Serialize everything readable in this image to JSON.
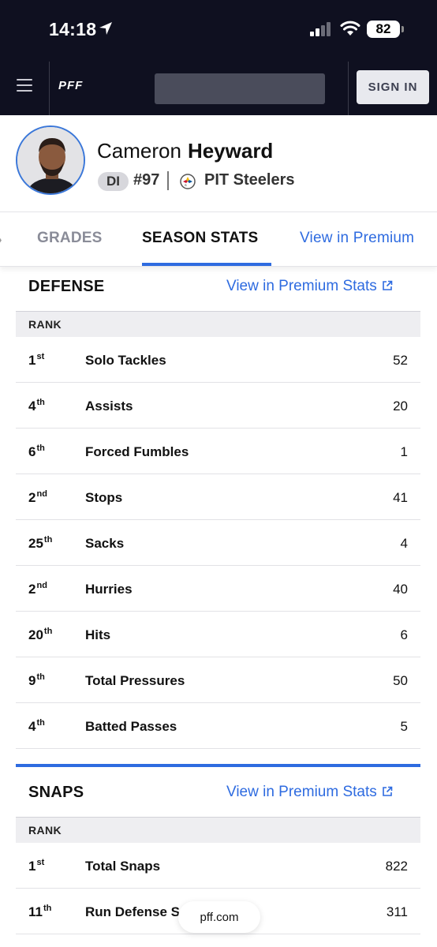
{
  "status_bar": {
    "time": "14:18",
    "battery": "82"
  },
  "header": {
    "logo": "PFF",
    "sign_in": "SIGN IN"
  },
  "player": {
    "first_name": "Cameron",
    "last_name": "Heyward",
    "position": "DI",
    "jersey": "#97",
    "team": "PIT Steelers"
  },
  "tabs": {
    "grades": "GRADES",
    "season_stats": "SEASON STATS",
    "premium": "View in Premium"
  },
  "defense": {
    "title": "DEFENSE",
    "link": "View in Premium Stats",
    "rank_header": "RANK",
    "rows": [
      {
        "rank": "1",
        "suffix": "st",
        "label": "Solo Tackles",
        "value": "52"
      },
      {
        "rank": "4",
        "suffix": "th",
        "label": "Assists",
        "value": "20"
      },
      {
        "rank": "6",
        "suffix": "th",
        "label": "Forced Fumbles",
        "value": "1"
      },
      {
        "rank": "2",
        "suffix": "nd",
        "label": "Stops",
        "value": "41"
      },
      {
        "rank": "25",
        "suffix": "th",
        "label": "Sacks",
        "value": "4"
      },
      {
        "rank": "2",
        "suffix": "nd",
        "label": "Hurries",
        "value": "40"
      },
      {
        "rank": "20",
        "suffix": "th",
        "label": "Hits",
        "value": "6"
      },
      {
        "rank": "9",
        "suffix": "th",
        "label": "Total Pressures",
        "value": "50"
      },
      {
        "rank": "4",
        "suffix": "th",
        "label": "Batted Passes",
        "value": "5"
      }
    ]
  },
  "snaps": {
    "title": "SNAPS",
    "link": "View in Premium Stats",
    "rank_header": "RANK",
    "rows": [
      {
        "rank": "1",
        "suffix": "st",
        "label": "Total Snaps",
        "value": "822"
      },
      {
        "rank": "11",
        "suffix": "th",
        "label": "Run Defense S",
        "value": "311"
      }
    ]
  },
  "browser": {
    "url": "pff.com"
  },
  "colors": {
    "accent": "#2e6be0",
    "header_bg": "#0f1020"
  }
}
